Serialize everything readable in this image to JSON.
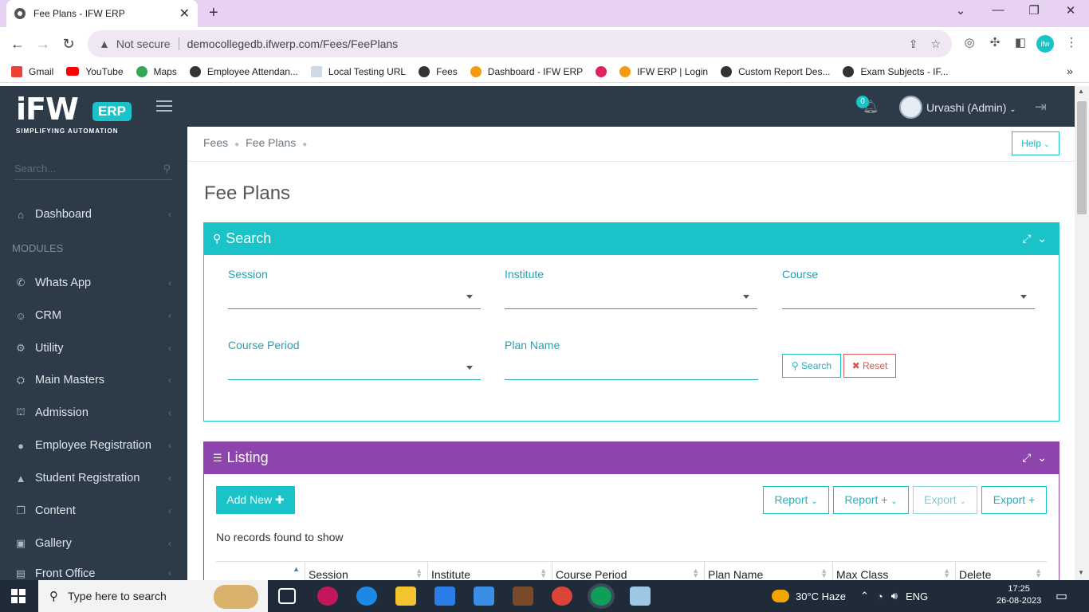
{
  "browser": {
    "tab_title": "Fee Plans - IFW ERP",
    "not_secure": "Not secure",
    "url": "democollegedb.ifwerp.com/Fees/FeePlans",
    "bookmarks": [
      "Gmail",
      "YouTube",
      "Maps",
      "Employee Attendan...",
      "Local Testing URL",
      "Fees",
      "Dashboard - IFW ERP",
      "IFW ERP | Login",
      "Custom Report Des...",
      "Exam Subjects - IF..."
    ]
  },
  "sidebar": {
    "logo_text": "iFW",
    "logo_badge": "ERP",
    "logo_tagline": "SIMPLIFYING AUTOMATION",
    "search_placeholder": "Search...",
    "dashboard": "Dashboard",
    "modules_heading": "MODULES",
    "items": [
      "Whats App",
      "CRM",
      "Utility",
      "Main Masters",
      "Admission",
      "Employee Registration",
      "Student Registration",
      "Content",
      "Gallery",
      "Front Office"
    ]
  },
  "header": {
    "notif_count": "0",
    "user_name": "Urvashi (Admin)"
  },
  "breadcrumb": {
    "items": [
      "Fees",
      "Fee Plans"
    ]
  },
  "help_label": "Help",
  "page_title": "Fee Plans",
  "search_panel": {
    "title": "Search",
    "session_label": "Session",
    "institute_label": "Institute",
    "course_label": "Course",
    "course_period_label": "Course Period",
    "plan_name_label": "Plan Name",
    "search_btn": "Search",
    "reset_btn": "Reset"
  },
  "listing_panel": {
    "title": "Listing",
    "add_new": "Add New",
    "report": "Report",
    "report_plus": "Report +",
    "export": "Export",
    "export_plus": "Export +",
    "empty_message": "No records found to show",
    "columns": [
      "Session",
      "Institute",
      "Course Period",
      "Plan Name",
      "Max Class",
      "Delete"
    ]
  },
  "taskbar": {
    "search_placeholder": "Type here to search",
    "weather": "30°C  Haze",
    "lang": "ENG",
    "time": "17:25",
    "date": "26-08-2023"
  }
}
